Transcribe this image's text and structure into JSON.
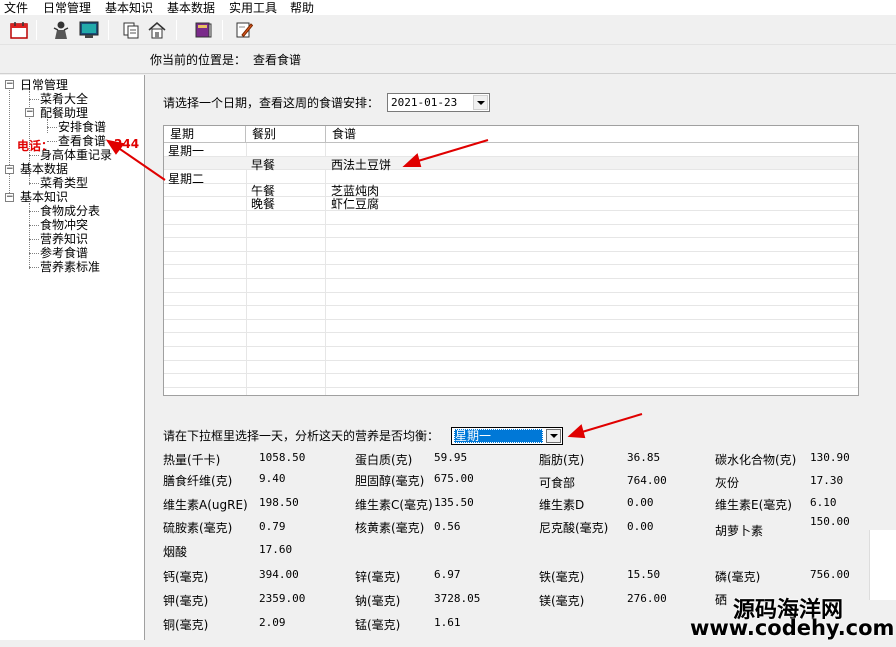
{
  "menu": [
    "文件",
    "日常管理",
    "基本知识",
    "基本数据",
    "实用工具",
    "帮助"
  ],
  "toolbar_icons": [
    "calendar-icon",
    "person-icon",
    "monitor-icon",
    "copy-icon",
    "home-icon",
    "book-icon",
    "edit-icon"
  ],
  "location": {
    "label": "你当前的位置是：",
    "value": "查看食谱"
  },
  "tree": {
    "daily": "日常管理",
    "dishes": "菜肴大全",
    "plan": "配餐助理",
    "arrange": "安排食谱",
    "view": "查看食谱",
    "body": "身高体重记录",
    "basic_data": "基本数据",
    "dish_types": "菜肴类型",
    "basic_knowledge": "基本知识",
    "food_comp": "食物成分表",
    "food_conflict": "食物冲突",
    "nutrition": "营养知识",
    "ref_recipes": "参考食谱",
    "nutrient_std": "营养素标准"
  },
  "overlay_phone": "电话：",
  "overlay_phone_tail": "244",
  "prompt1": "请选择一个日期，查看这周的食谱安排：",
  "date_value": "2021-01-23",
  "grid": {
    "headers": [
      "星期",
      "餐别",
      "食谱"
    ],
    "rows": [
      [
        "星期一",
        "",
        ""
      ],
      [
        "",
        "早餐",
        "西法土豆饼"
      ],
      [
        "星期二",
        "",
        ""
      ],
      [
        "",
        "午餐",
        "芝蓝炖肉"
      ],
      [
        "",
        "晚餐",
        "虾仁豆腐"
      ]
    ]
  },
  "prompt2": "请在下拉框里选择一天，分析这天的营养是否均衡：",
  "day_value": "星期一",
  "nutrients": {
    "energy": "热量(千卡)",
    "energy_v": "1058.50",
    "protein": "蛋白质(克)",
    "protein_v": "59.95",
    "fat": "脂肪(克)",
    "fat_v": "36.85",
    "carb": "碳水化合物(克)",
    "carb_v": "130.90",
    "fiber": "膳食纤维(克)",
    "fiber_v": "9.40",
    "chol": "胆固醇(毫克)",
    "chol_v": "675.00",
    "edible": "可食部",
    "edible_v": "764.00",
    "ash": "灰份",
    "ash_v": "17.30",
    "vita": "维生素A(ugRE)",
    "vita_v": "198.50",
    "vitc": "维生素C(毫克)",
    "vitc_v": "135.50",
    "vitd": "维生素D",
    "vitd_v": "0.00",
    "vite": "维生素E(毫克)",
    "vite_v": "6.10",
    "thiamin": "硫胺素(毫克)",
    "thiamin_v": "0.79",
    "ribo": "核黄素(毫克)",
    "ribo_v": "0.56",
    "niacin": "尼克酸(毫克)",
    "niacin_v": "0.00",
    "carotene": "胡萝卜素",
    "carotene_v": "150.00",
    "nicotinic": "烟酸",
    "nicotinic_v": "17.60",
    "ca": "钙(毫克)",
    "ca_v": "394.00",
    "zn": "锌(毫克)",
    "zn_v": "6.97",
    "fe": "铁(毫克)",
    "fe_v": "15.50",
    "p": "磷(毫克)",
    "p_v": "756.00",
    "k": "钾(毫克)",
    "k_v": "2359.00",
    "na": "钠(毫克)",
    "na_v": "3728.05",
    "mg": "镁(毫克)",
    "mg_v": "276.00",
    "se": "硒",
    "cu": "铜(毫克)",
    "cu_v": "2.09",
    "mn": "锰(毫克)",
    "mn_v": "1.61"
  },
  "watermark": {
    "line1": "源码海洋网",
    "line2": "www.codehy.com"
  },
  "colors": {
    "arrow": "#e00000",
    "selection": "#0078d7"
  }
}
